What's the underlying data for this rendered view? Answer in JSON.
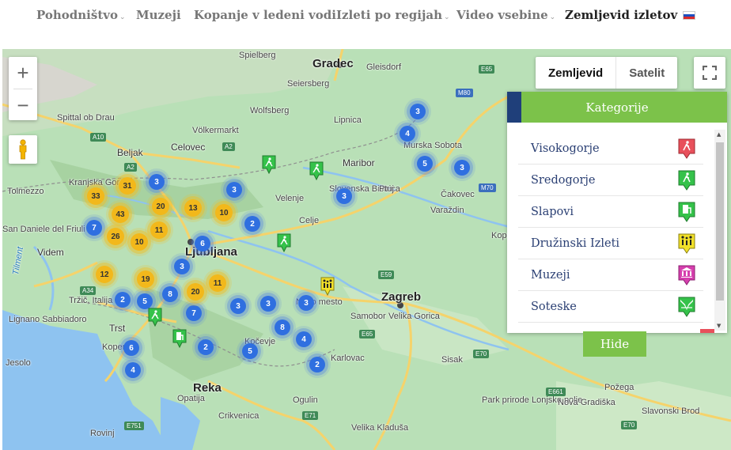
{
  "nav": {
    "items": [
      {
        "label": "Pohodništvo",
        "has_caret": true
      },
      {
        "label": "Muzeji",
        "has_caret": false
      },
      {
        "label": "Kopanje v ledeni vodi",
        "has_caret": false
      },
      {
        "label": "Izleti po regijah",
        "has_caret": true
      },
      {
        "label": "Video vsebine",
        "has_caret": true
      },
      {
        "label": "Zemljevid izletov",
        "has_caret": false,
        "active": true
      }
    ],
    "caret_glyph": "⌄",
    "flag": "slovenia-flag-icon"
  },
  "map": {
    "controls": {
      "zoom_in": "+",
      "zoom_out": "−",
      "map_type": [
        "Zemljevid",
        "Satelit"
      ],
      "selected_map_type": "Zemljevid"
    },
    "places": [
      {
        "text": "Spielberg",
        "cls": ""
      },
      {
        "text": "Gradec",
        "cls": "big"
      },
      {
        "text": "Gleisdorf",
        "cls": ""
      },
      {
        "text": "Seiersberg",
        "cls": ""
      },
      {
        "text": "Spittal ob Drau",
        "cls": ""
      },
      {
        "text": "Völkermarkt",
        "cls": ""
      },
      {
        "text": "Lipnica",
        "cls": ""
      },
      {
        "text": "Wolfsberg",
        "cls": ""
      },
      {
        "text": "Beljak",
        "cls": "mid"
      },
      {
        "text": "Celovec",
        "cls": "mid"
      },
      {
        "text": "Maribor",
        "cls": "mid"
      },
      {
        "text": "Murska Sobota",
        "cls": ""
      },
      {
        "text": "Kranjska Gora",
        "cls": ""
      },
      {
        "text": "Velenje",
        "cls": ""
      },
      {
        "text": "Slovenska Bistrica",
        "cls": ""
      },
      {
        "text": "Ptuj",
        "cls": ""
      },
      {
        "text": "Čakovec",
        "cls": ""
      },
      {
        "text": "Tolmezzo",
        "cls": ""
      },
      {
        "text": "Celje",
        "cls": ""
      },
      {
        "text": "Varaždin",
        "cls": ""
      },
      {
        "text": "San Daniele del Friuli",
        "cls": ""
      },
      {
        "text": "Videm",
        "cls": "mid"
      },
      {
        "text": "Ljubljana",
        "cls": "big"
      },
      {
        "text": "Koprivnica",
        "cls": ""
      },
      {
        "text": "Novo mesto",
        "cls": ""
      },
      {
        "text": "Zagreb",
        "cls": "big"
      },
      {
        "text": "Tržič, Italija",
        "cls": ""
      },
      {
        "text": "Lignano Sabbiadoro",
        "cls": ""
      },
      {
        "text": "Samobor",
        "cls": ""
      },
      {
        "text": "Velika Gorica",
        "cls": ""
      },
      {
        "text": "Trst",
        "cls": "mid"
      },
      {
        "text": "Kočevje",
        "cls": ""
      },
      {
        "text": "Koper",
        "cls": ""
      },
      {
        "text": "Jesolo",
        "cls": ""
      },
      {
        "text": "Karlovac",
        "cls": ""
      },
      {
        "text": "Sisak",
        "cls": ""
      },
      {
        "text": "Reka",
        "cls": "big"
      },
      {
        "text": "Požega",
        "cls": ""
      },
      {
        "text": "Opatija",
        "cls": ""
      },
      {
        "text": "Ogulin",
        "cls": ""
      },
      {
        "text": "Park prirode Lonjsko polje",
        "cls": ""
      },
      {
        "text": "Nova Gradiška",
        "cls": ""
      },
      {
        "text": "Slavonski Brod",
        "cls": ""
      },
      {
        "text": "Crikvenica",
        "cls": ""
      },
      {
        "text": "Velika Kladuša",
        "cls": ""
      },
      {
        "text": "Rovinj",
        "cls": ""
      },
      {
        "text": "Tilment",
        "cls": "water"
      }
    ],
    "roads": [
      "A10",
      "A2",
      "A2",
      "A34",
      "E65",
      "M80",
      "M70",
      "E59",
      "E70",
      "E661",
      "E751",
      "E71",
      "E65",
      "E70"
    ],
    "clusters": [
      {
        "n": "3",
        "c": "blue"
      },
      {
        "n": "4",
        "c": "blue"
      },
      {
        "n": "5",
        "c": "blue"
      },
      {
        "n": "3",
        "c": "blue"
      },
      {
        "n": "3",
        "c": "blue"
      },
      {
        "n": "3",
        "c": "blue"
      },
      {
        "n": "3",
        "c": "blue"
      },
      {
        "n": "2",
        "c": "blue"
      },
      {
        "n": "7",
        "c": "blue"
      },
      {
        "n": "6",
        "c": "blue"
      },
      {
        "n": "3",
        "c": "blue"
      },
      {
        "n": "8",
        "c": "blue"
      },
      {
        "n": "2",
        "c": "blue"
      },
      {
        "n": "5",
        "c": "blue"
      },
      {
        "n": "7",
        "c": "blue"
      },
      {
        "n": "3",
        "c": "blue"
      },
      {
        "n": "3",
        "c": "blue"
      },
      {
        "n": "3",
        "c": "blue"
      },
      {
        "n": "8",
        "c": "blue"
      },
      {
        "n": "4",
        "c": "blue"
      },
      {
        "n": "6",
        "c": "blue"
      },
      {
        "n": "2",
        "c": "blue"
      },
      {
        "n": "5",
        "c": "blue"
      },
      {
        "n": "4",
        "c": "blue"
      },
      {
        "n": "2",
        "c": "blue"
      },
      {
        "n": "33",
        "c": "yellow"
      },
      {
        "n": "31",
        "c": "yellow"
      },
      {
        "n": "43",
        "c": "yellow"
      },
      {
        "n": "20",
        "c": "yellow"
      },
      {
        "n": "13",
        "c": "yellow"
      },
      {
        "n": "10",
        "c": "yellow"
      },
      {
        "n": "26",
        "c": "yellow"
      },
      {
        "n": "10",
        "c": "yellow"
      },
      {
        "n": "11",
        "c": "yellow"
      },
      {
        "n": "12",
        "c": "yellow"
      },
      {
        "n": "19",
        "c": "yellow"
      },
      {
        "n": "20",
        "c": "yellow"
      },
      {
        "n": "11",
        "c": "yellow"
      }
    ],
    "pins": [
      "hiker-pin-icon",
      "hiker-pin-icon",
      "hiker-pin-icon",
      "hiker-pin-icon",
      "waterfall-pin-icon",
      "family-pin-icon"
    ]
  },
  "panel": {
    "title": "Kategorije",
    "categories": [
      {
        "label": "Visokogorje",
        "icon": "mountain-hiker-icon",
        "color": "#e8505b"
      },
      {
        "label": "Sredogorje",
        "icon": "hiker-icon",
        "color": "#35c24a"
      },
      {
        "label": "Slapovi",
        "icon": "waterfall-icon",
        "color": "#35c24a"
      },
      {
        "label": "Družinski Izleti",
        "icon": "family-icon",
        "color": "#f1e02a"
      },
      {
        "label": "Muzeji",
        "icon": "museum-icon",
        "color": "#d63fae"
      },
      {
        "label": "Soteske",
        "icon": "gorge-icon",
        "color": "#35c24a"
      }
    ],
    "hide_label": "Hide"
  },
  "colors": {
    "accent_green": "#7cc24a",
    "panel_tab": "#1f3f7a",
    "cluster_blue": "#2f6fe0",
    "cluster_yellow": "#f2b81b"
  }
}
